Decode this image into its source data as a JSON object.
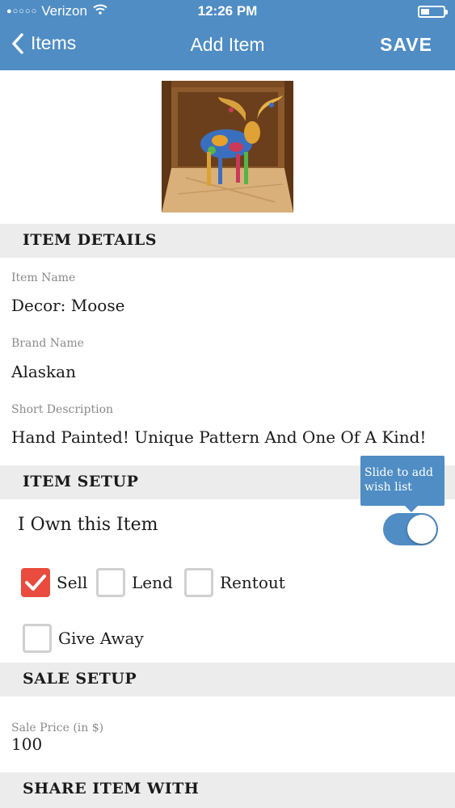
{
  "status": {
    "carrier": "Verizon",
    "time": "12:26 PM"
  },
  "nav": {
    "back_label": "Items",
    "title": "Add Item",
    "save_label": "SAVE"
  },
  "sections": {
    "item_details": "ITEM DETAILS",
    "item_setup": "ITEM SETUP",
    "sale_setup": "SALE SETUP",
    "share_item_with": "SHARE ITEM WITH"
  },
  "fields": {
    "item_name": {
      "label": "Item Name",
      "value": "Decor: Moose"
    },
    "brand_name": {
      "label": "Brand Name",
      "value": "Alaskan"
    },
    "short_description": {
      "label": "Short Description",
      "value": "Hand Painted! Unique Pattern And One Of A Kind!"
    },
    "sale_price": {
      "label": "Sale Price (in $)",
      "value": "100"
    }
  },
  "ownership": {
    "label": "I Own this Item",
    "toggle_on": true,
    "tooltip": "Slide to add wish list"
  },
  "options": {
    "sell": {
      "label": "Sell",
      "checked": true
    },
    "lend": {
      "label": "Lend",
      "checked": false
    },
    "rentout": {
      "label": "Rentout",
      "checked": false
    },
    "give_away": {
      "label": "Give Away",
      "checked": false
    }
  },
  "colors": {
    "accent": "#4f8dc4",
    "checked": "#ea4b3f",
    "section_bg": "#ececec"
  }
}
